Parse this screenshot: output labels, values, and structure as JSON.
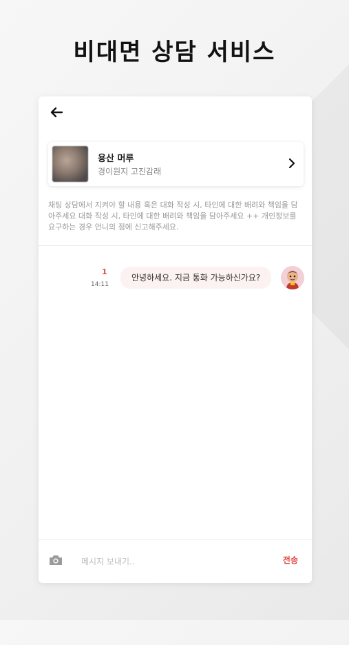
{
  "headline": "비대면 상담 서비스",
  "header": {
    "back_icon": "arrow-left-icon"
  },
  "profile": {
    "name": "용산 머루",
    "subtitle": "경이원지 고진감래",
    "chevron_icon": "chevron-right-icon"
  },
  "notice": "채팅 상담에서 지켜야 할 내용 혹은 대화 작성 시, 타인에 대한 배려와 책임을 담아주세요 대화 작성 시, 타인에 대한 배려와 책임을 담아주세요 ++ 개인정보를 요구하는 경우 언니의 점에 신고해주세요.",
  "messages": [
    {
      "text": "안녕하세요. 지금 통화 가능하신가요?",
      "time": "14:11",
      "unread_count": "1"
    }
  ],
  "composer": {
    "placeholder": "메시지 보내기..",
    "send_label": "전송",
    "camera_icon": "camera-icon"
  },
  "colors": {
    "accent": "#e04a4a",
    "bubble_bg": "#fdf2f2"
  }
}
